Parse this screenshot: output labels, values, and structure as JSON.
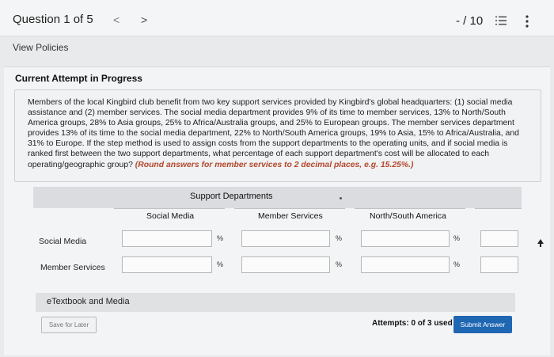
{
  "header": {
    "question_counter": "Question 1 of 5",
    "prev_glyph": "<",
    "next_glyph": ">",
    "score": "- / 10",
    "icons": [
      "list-icon",
      "kebab-icon"
    ]
  },
  "view_policies": "View Policies",
  "attempt_status": "Current Attempt in Progress",
  "question": {
    "text": "Members of the local Kingbird club benefit from two key support services provided by Kingbird's global headquarters: (1) social media assistance and (2) member services. The social media department provides 9% of its time to member services, 13% to North/South America groups, 28% to Asia groups, 25% to Africa/Australia groups, and 25% to European groups. The member services department provides 13% of its time to the social media department, 22% to North/South America groups, 19% to Asia, 15% to Africa/Australia, and 31% to Europe. If the step method is used to assign costs from the support departments to the operating units, and if social media is ranked first between the two support departments, what percentage of each support department's cost will be allocated to each operating/geographic group?",
    "hint": "(Round answers for member services to 2 decimal places, e.g. 15.25%.)"
  },
  "table": {
    "group_header": "Support Departments",
    "columns": [
      "Social Media",
      "Member Services",
      "North/South America"
    ],
    "rows": [
      {
        "label": "Social Media",
        "cells": [
          "",
          "",
          "",
          ""
        ]
      },
      {
        "label": "Member Services",
        "cells": [
          "",
          "",
          "",
          ""
        ]
      }
    ],
    "percent_sign": "%"
  },
  "etextbook": "eTextbook and Media",
  "footer": {
    "save_label": "Save for Later",
    "attempts": "Attempts: 0 of 3 used",
    "submit_label": "Submit Answer"
  },
  "colors": {
    "accent": "#1f66b3",
    "hint": "#b3472c",
    "background": "#e9eaec"
  }
}
